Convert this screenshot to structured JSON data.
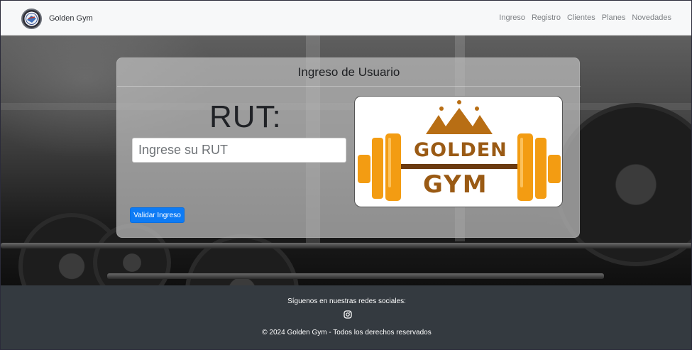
{
  "navbar": {
    "brand_name": "Golden Gym",
    "links": [
      "Ingreso",
      "Registro",
      "Clientes",
      "Planes",
      "Novedades"
    ]
  },
  "login_card": {
    "title": "Ingreso de Usuario",
    "rut_label": "RUT:",
    "rut_input": {
      "value": "",
      "placeholder": "Ingrese su RUT"
    },
    "submit_label": "Validar Ingreso",
    "logo": {
      "line1": "GOLDEN",
      "line2": "GYM"
    }
  },
  "footer": {
    "social_text": "Síguenos en nuestras redes sociales:",
    "social_icon": "instagram-icon",
    "copyright": "© 2024 Golden Gym - Todos los derechos reservados"
  },
  "colors": {
    "primary_button": "#0d7bf5",
    "footer_bg": "#343a40",
    "logo_orange": "#f39c12",
    "logo_brown": "#9a5a14"
  }
}
